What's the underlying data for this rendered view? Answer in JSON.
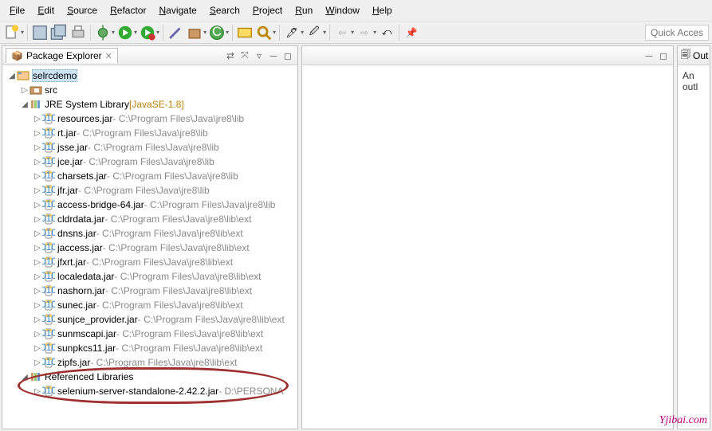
{
  "menu": [
    "File",
    "Edit",
    "Source",
    "Refactor",
    "Navigate",
    "Search",
    "Project",
    "Run",
    "Window",
    "Help"
  ],
  "quick_access_placeholder": "Quick Access",
  "package_explorer": {
    "title": "Package Explorer",
    "project": "selrcdemo",
    "src": "src",
    "jre_lib": "JRE System Library",
    "jre_suffix": " [JavaSE-1.8]",
    "jars": [
      {
        "name": "resources.jar",
        "path": " - C:\\Program Files\\Java\\jre8\\lib"
      },
      {
        "name": "rt.jar",
        "path": " - C:\\Program Files\\Java\\jre8\\lib"
      },
      {
        "name": "jsse.jar",
        "path": " - C:\\Program Files\\Java\\jre8\\lib"
      },
      {
        "name": "jce.jar",
        "path": " - C:\\Program Files\\Java\\jre8\\lib"
      },
      {
        "name": "charsets.jar",
        "path": " - C:\\Program Files\\Java\\jre8\\lib"
      },
      {
        "name": "jfr.jar",
        "path": " - C:\\Program Files\\Java\\jre8\\lib"
      },
      {
        "name": "access-bridge-64.jar",
        "path": " - C:\\Program Files\\Java\\jre8\\lib"
      },
      {
        "name": "cldrdata.jar",
        "path": " - C:\\Program Files\\Java\\jre8\\lib\\ext"
      },
      {
        "name": "dnsns.jar",
        "path": " - C:\\Program Files\\Java\\jre8\\lib\\ext"
      },
      {
        "name": "jaccess.jar",
        "path": " - C:\\Program Files\\Java\\jre8\\lib\\ext"
      },
      {
        "name": "jfxrt.jar",
        "path": " - C:\\Program Files\\Java\\jre8\\lib\\ext"
      },
      {
        "name": "localedata.jar",
        "path": " - C:\\Program Files\\Java\\jre8\\lib\\ext"
      },
      {
        "name": "nashorn.jar",
        "path": " - C:\\Program Files\\Java\\jre8\\lib\\ext"
      },
      {
        "name": "sunec.jar",
        "path": " - C:\\Program Files\\Java\\jre8\\lib\\ext"
      },
      {
        "name": "sunjce_provider.jar",
        "path": " - C:\\Program Files\\Java\\jre8\\lib\\ext"
      },
      {
        "name": "sunmscapi.jar",
        "path": " - C:\\Program Files\\Java\\jre8\\lib\\ext"
      },
      {
        "name": "sunpkcs11.jar",
        "path": " - C:\\Program Files\\Java\\jre8\\lib\\ext"
      },
      {
        "name": "zipfs.jar",
        "path": " - C:\\Program Files\\Java\\jre8\\lib\\ext"
      }
    ],
    "ref_lib": "Referenced Libraries",
    "ref_jars": [
      {
        "name": "selenium-server-standalone-2.42.2.jar",
        "path": " - D:\\PERSONA"
      }
    ]
  },
  "outline": {
    "title": "Out",
    "body": "An outl"
  },
  "watermark": "Yjibai.com"
}
